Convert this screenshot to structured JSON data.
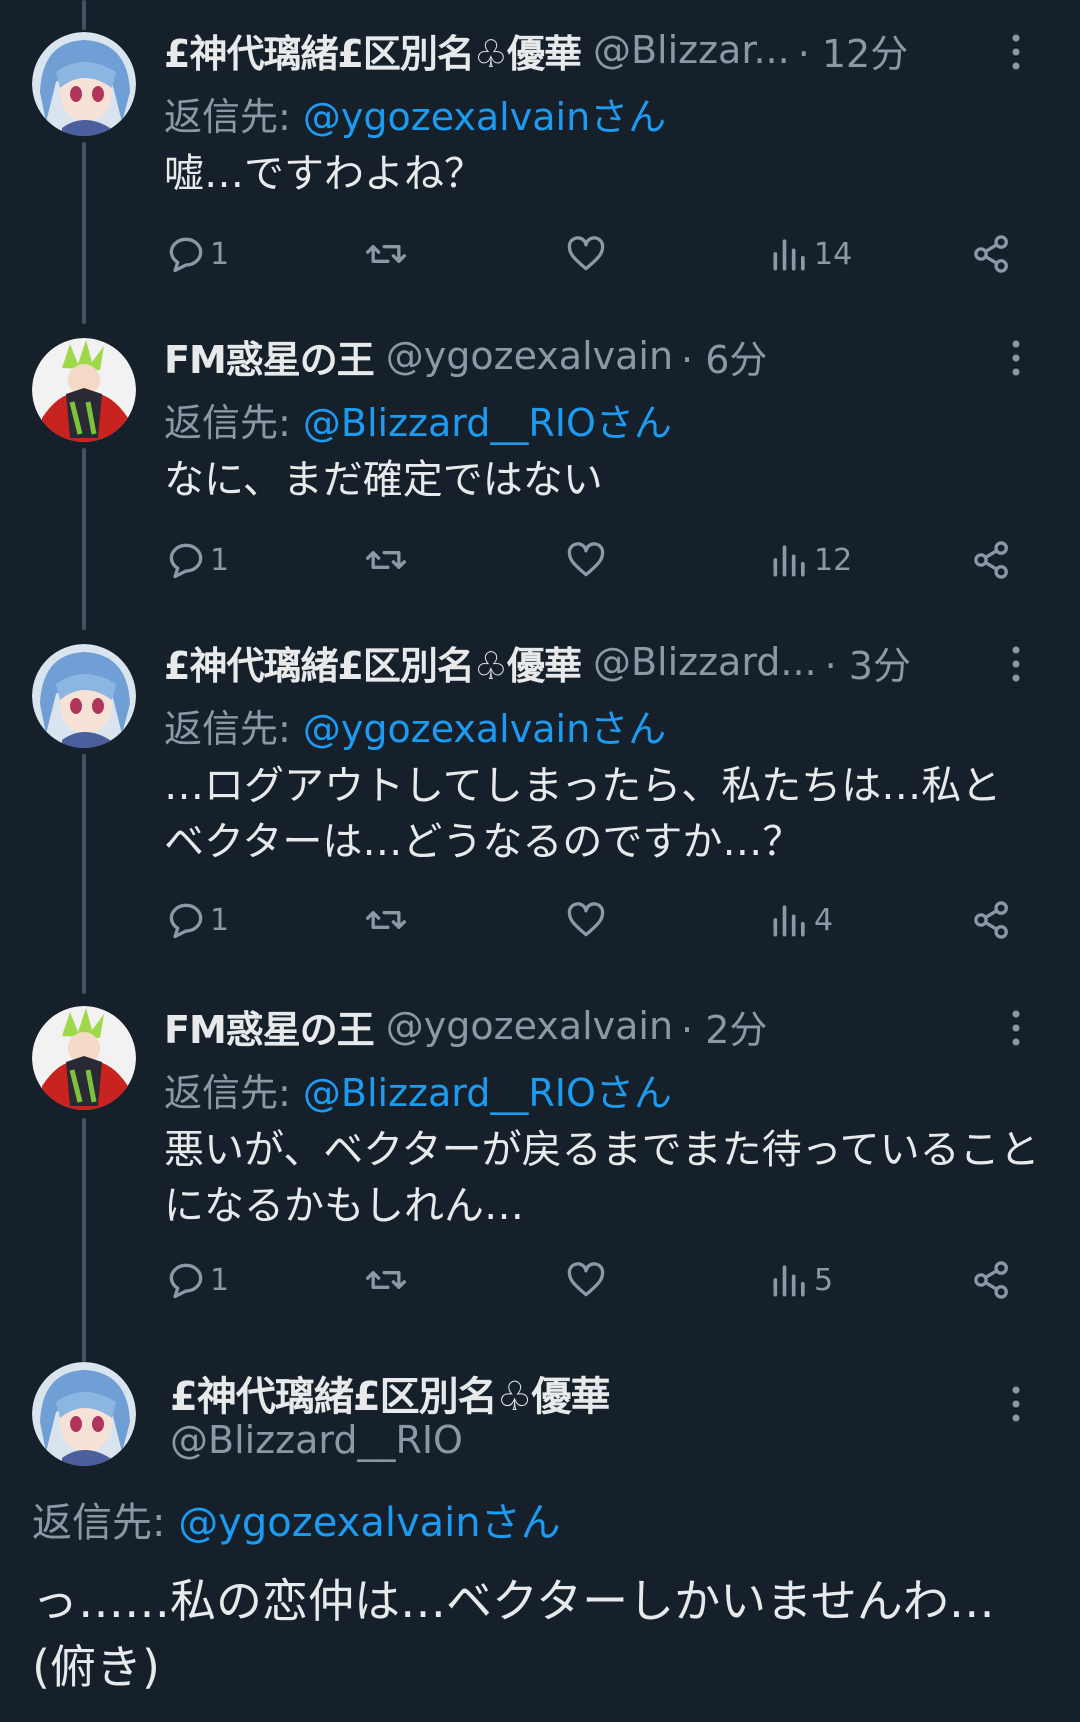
{
  "colors": {
    "background": "#15202b",
    "text": "#e7e9ea",
    "secondary_text": "#8b98a5",
    "link": "#1d9bf0",
    "thread_line": "#425364"
  },
  "tweets": [
    {
      "display_name": "£神代璃緒£区別名♧優華",
      "handle": "@Blizzar...",
      "time": "· 12分",
      "reply_label": "返信先: ",
      "reply_mention": "@ygozexalvainさん",
      "text": "嘘…ですわよね？",
      "replies": "1",
      "views": "14",
      "avatar": "blue-hair-girl"
    },
    {
      "display_name": "FM惑星の王",
      "handle": "@ygozexalvain",
      "time": "· 6分",
      "reply_label": "返信先: ",
      "reply_mention": "@Blizzard__RIOさん",
      "text": "なに、まだ確定ではない",
      "replies": "1",
      "views": "12",
      "avatar": "green-hair-villain"
    },
    {
      "display_name": "£神代璃緒£区別名♧優華",
      "handle": "@Blizzard...",
      "time": "· 3分",
      "reply_label": "返信先: ",
      "reply_mention": "@ygozexalvainさん",
      "text": "…ログアウトしてしまったら、私たちは…私とベクターは…どうなるのですか…？",
      "replies": "1",
      "views": "4",
      "avatar": "blue-hair-girl"
    },
    {
      "display_name": "FM惑星の王",
      "handle": "@ygozexalvain",
      "time": "· 2分",
      "reply_label": "返信先: ",
      "reply_mention": "@Blizzard__RIOさん",
      "text": "悪いが、ベクターが戻るまでまた待っていることになるかもしれん…",
      "replies": "1",
      "views": "5",
      "avatar": "green-hair-villain"
    }
  ],
  "focus_tweet": {
    "display_name": "£神代璃緒£区別名♧優華",
    "handle": "@Blizzard__RIO",
    "reply_label": "返信先: ",
    "reply_mention": "@ygozexalvainさん",
    "text": "っ……私の恋仲は…ベクターしかいませんわ…(俯き)",
    "avatar": "blue-hair-girl"
  },
  "icons": {
    "reply": "reply-icon",
    "retweet": "retweet-icon",
    "like": "like-icon",
    "views": "views-icon",
    "share": "share-icon",
    "more": "more-icon"
  }
}
